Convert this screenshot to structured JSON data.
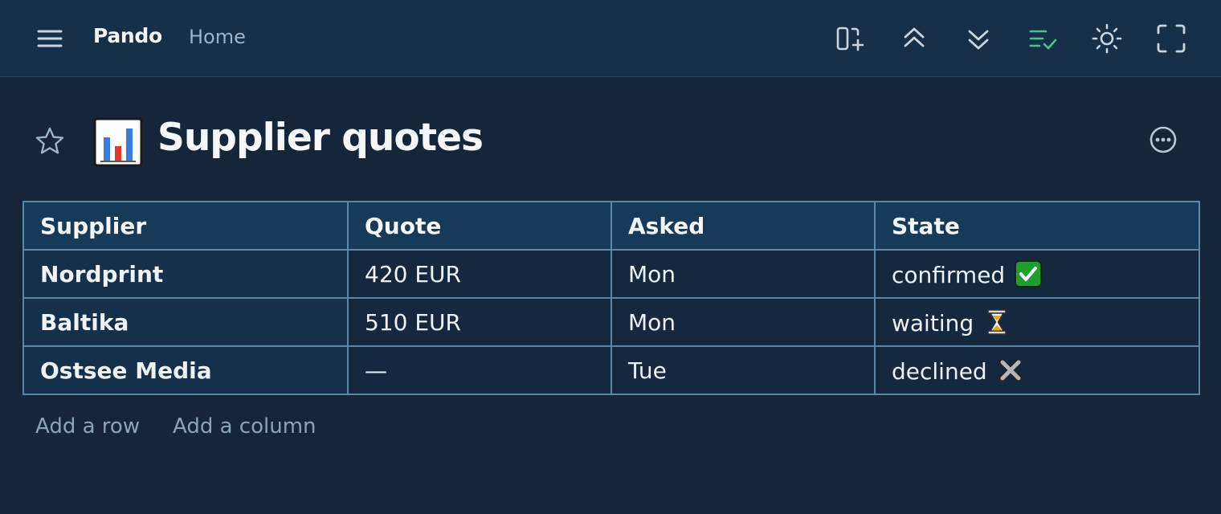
{
  "topbar": {
    "app_name": "Pando",
    "breadcrumb": "Home",
    "icons": [
      "menu-icon",
      "new-page-icon",
      "collapse-all-icon",
      "expand-all-icon",
      "checklist-icon",
      "theme-sun-icon",
      "fullscreen-icon"
    ],
    "checklist_color": "#4cc38a"
  },
  "page": {
    "title": "Supplier quotes",
    "title_icon": "bar-chart-emoji"
  },
  "table": {
    "columns": [
      "Supplier",
      "Quote",
      "Asked",
      "State"
    ],
    "rows": [
      {
        "supplier": "Nordprint",
        "quote": "420 EUR",
        "asked": "Mon",
        "state": "confirmed",
        "state_icon": "check-mark-icon"
      },
      {
        "supplier": "Baltika",
        "quote": "510 EUR",
        "asked": "Mon",
        "state": "waiting",
        "state_icon": "hourglass-icon"
      },
      {
        "supplier": "Ostsee Media",
        "quote": "—",
        "asked": "Tue",
        "state": "declined",
        "state_icon": "cross-mark-icon"
      }
    ]
  },
  "actions": {
    "add_row": "Add a row",
    "add_column": "Add a column"
  }
}
